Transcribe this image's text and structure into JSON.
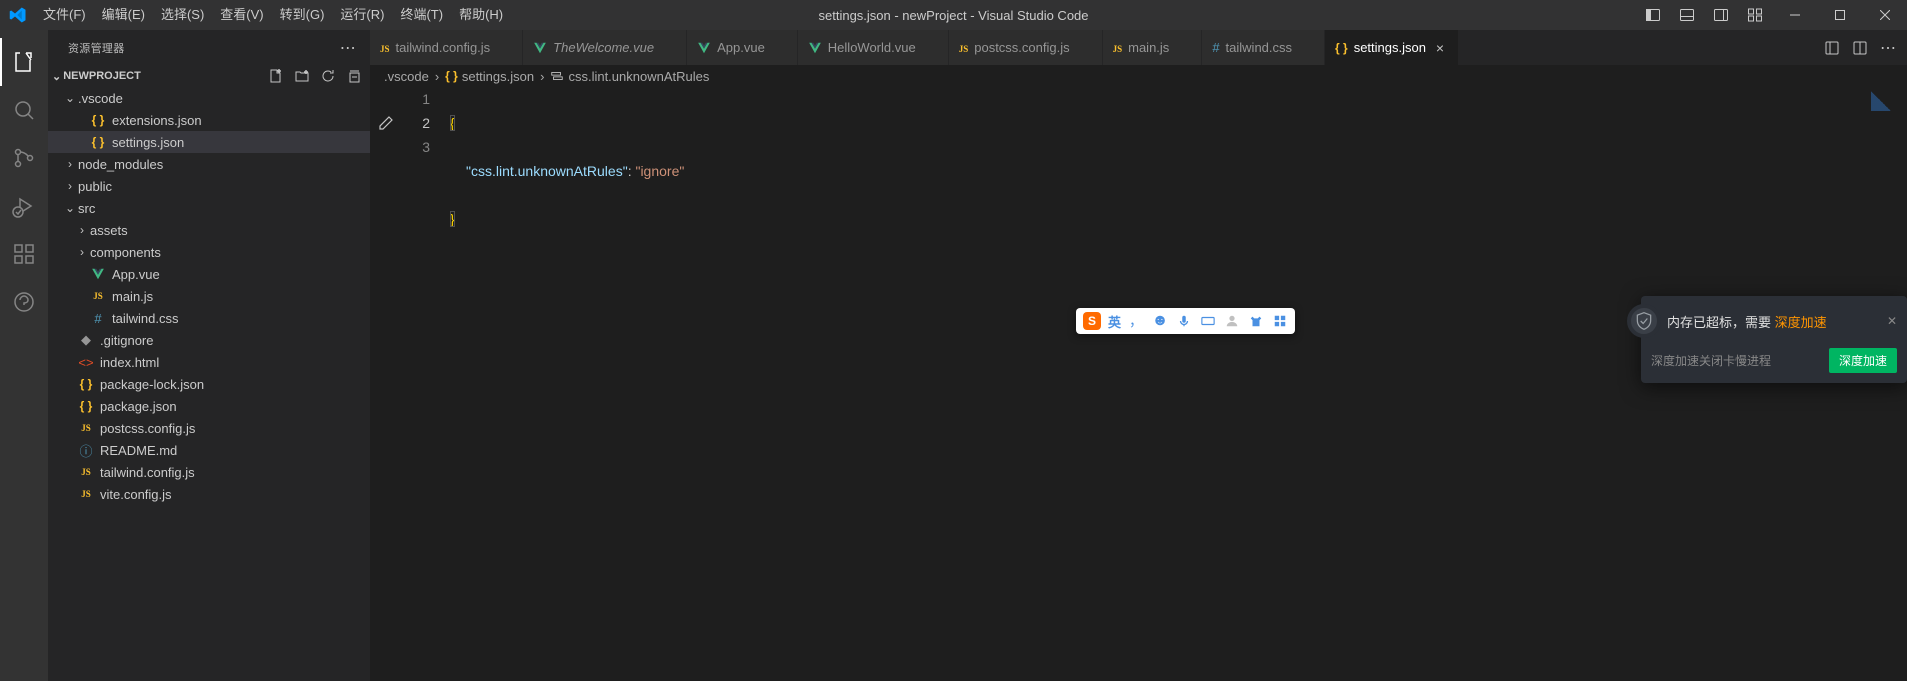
{
  "titlebar": {
    "menu": [
      "文件(F)",
      "编辑(E)",
      "选择(S)",
      "查看(V)",
      "转到(G)",
      "运行(R)",
      "终端(T)",
      "帮助(H)"
    ],
    "title": "settings.json - newProject - Visual Studio Code"
  },
  "sidebar": {
    "title": "资源管理器",
    "section": "NEWPROJECT",
    "tree": [
      {
        "type": "folder",
        "open": true,
        "indent": 0,
        "name": ".vscode"
      },
      {
        "type": "file",
        "indent": 1,
        "icon": "braces",
        "name": "extensions.json"
      },
      {
        "type": "file",
        "indent": 1,
        "icon": "braces",
        "name": "settings.json",
        "selected": true
      },
      {
        "type": "folder",
        "open": false,
        "indent": 0,
        "name": "node_modules"
      },
      {
        "type": "folder",
        "open": false,
        "indent": 0,
        "name": "public"
      },
      {
        "type": "folder",
        "open": true,
        "indent": 0,
        "name": "src"
      },
      {
        "type": "folder",
        "open": false,
        "indent": 1,
        "name": "assets"
      },
      {
        "type": "folder",
        "open": false,
        "indent": 1,
        "name": "components"
      },
      {
        "type": "file",
        "indent": 1,
        "icon": "vue",
        "name": "App.vue"
      },
      {
        "type": "file",
        "indent": 1,
        "icon": "js",
        "name": "main.js"
      },
      {
        "type": "file",
        "indent": 1,
        "icon": "hash",
        "name": "tailwind.css"
      },
      {
        "type": "file",
        "indent": 0,
        "icon": "git",
        "name": ".gitignore"
      },
      {
        "type": "file",
        "indent": 0,
        "icon": "html",
        "name": "index.html"
      },
      {
        "type": "file",
        "indent": 0,
        "icon": "braces",
        "name": "package-lock.json"
      },
      {
        "type": "file",
        "indent": 0,
        "icon": "braces",
        "name": "package.json"
      },
      {
        "type": "file",
        "indent": 0,
        "icon": "js",
        "name": "postcss.config.js"
      },
      {
        "type": "file",
        "indent": 0,
        "icon": "info",
        "name": "README.md"
      },
      {
        "type": "file",
        "indent": 0,
        "icon": "js",
        "name": "tailwind.config.js"
      },
      {
        "type": "file",
        "indent": 0,
        "icon": "js",
        "name": "vite.config.js"
      }
    ]
  },
  "tabs": [
    {
      "icon": "js",
      "label": "tailwind.config.js"
    },
    {
      "icon": "vue",
      "label": "TheWelcome.vue",
      "italic": true
    },
    {
      "icon": "vue",
      "label": "App.vue"
    },
    {
      "icon": "vue",
      "label": "HelloWorld.vue"
    },
    {
      "icon": "js",
      "label": "postcss.config.js"
    },
    {
      "icon": "js",
      "label": "main.js"
    },
    {
      "icon": "hash",
      "label": "tailwind.css"
    },
    {
      "icon": "braces",
      "label": "settings.json",
      "active": true
    }
  ],
  "breadcrumb": {
    "parts": [
      {
        "label": ".vscode"
      },
      {
        "icon": "braces",
        "label": "settings.json"
      },
      {
        "icon": "symbol",
        "label": "css.lint.unknownAtRules"
      }
    ]
  },
  "editor": {
    "lines": [
      "1",
      "2",
      "3"
    ],
    "current": "2",
    "code": {
      "key": "\"css.lint.unknownAtRules\"",
      "value": "\"ignore\""
    }
  },
  "ime": {
    "lang": "英",
    "punct": "，"
  },
  "qq": {
    "msg_prefix": "内存已超标，需要",
    "msg_highlight": "深度加速",
    "sub": "深度加速关闭卡慢进程",
    "btn": "深度加速"
  }
}
